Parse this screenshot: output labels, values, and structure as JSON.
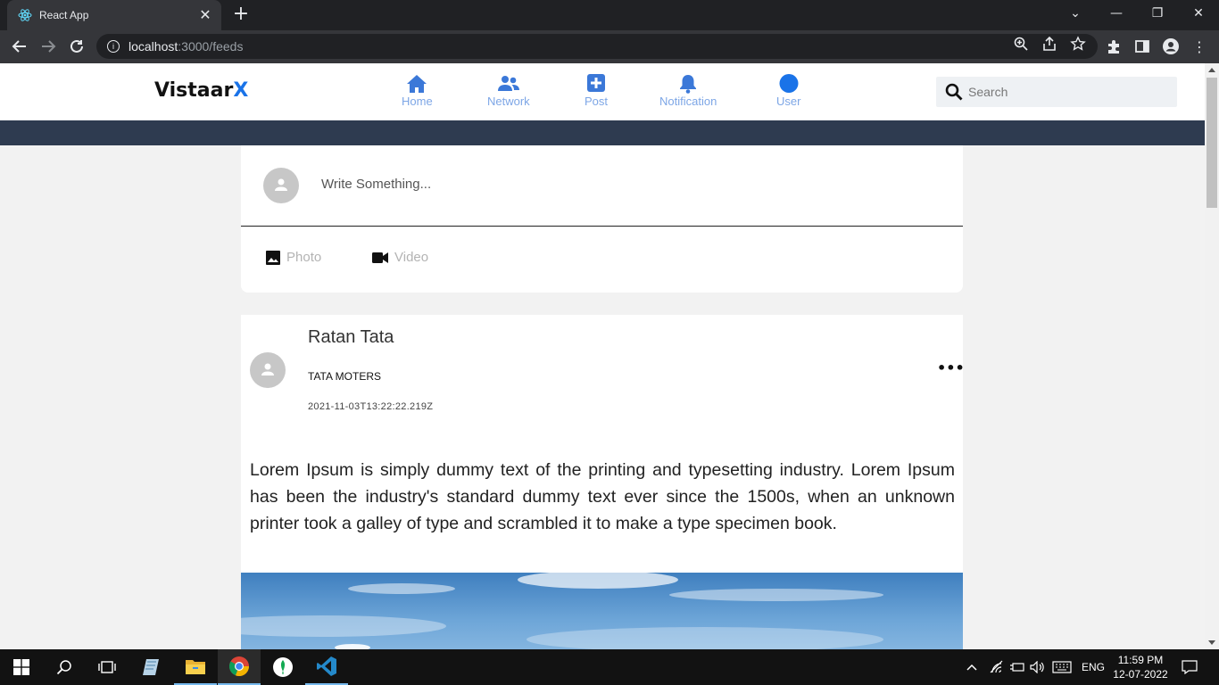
{
  "browser": {
    "tab_title": "React App",
    "url_host": "localhost",
    "url_path": ":3000/feeds"
  },
  "app": {
    "logo_main": "Vistaar",
    "logo_accent": "X",
    "nav": [
      {
        "label": "Home"
      },
      {
        "label": "Network"
      },
      {
        "label": "Post"
      },
      {
        "label": "Notification"
      },
      {
        "label": "User"
      }
    ],
    "search_placeholder": "Search",
    "accent_color": "#1a73e8"
  },
  "compose": {
    "placeholder": "Write Something...",
    "photo_label": "Photo",
    "video_label": "Video"
  },
  "post": {
    "author": "Ratan Tata",
    "company": "TATA MOTERS",
    "timestamp": "2021-11-03T13:22:22.219Z",
    "body": "Lorem Ipsum is simply dummy text of the printing and typesetting industry. Lorem Ipsum has been the industry's standard dummy text ever since the 1500s, when an unknown printer took a galley of type and scrambled it to make a type specimen book.",
    "more": "•••"
  },
  "taskbar": {
    "lang": "ENG",
    "time": "11:59 PM",
    "date": "12-07-2022"
  }
}
